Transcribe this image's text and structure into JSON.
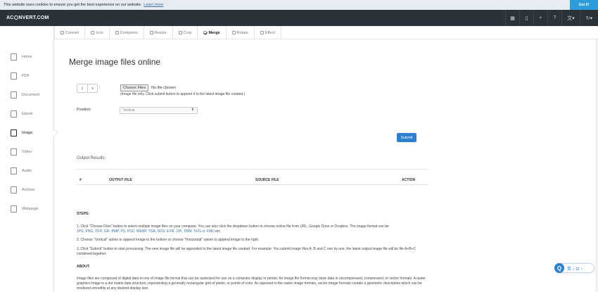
{
  "cookie": {
    "text": "This website uses cookies to ensure you get the best experience on our website.",
    "link": "Learn more",
    "button": "Got it!"
  },
  "topnav": {
    "logo_left": "AC",
    "logo_right": "NVERT.COM",
    "icons": [
      {
        "name": "grid-icon",
        "glyph": "▦"
      },
      {
        "name": "mobile-icon",
        "glyph": "▯"
      },
      {
        "name": "search-icon",
        "glyph": "⌕"
      },
      {
        "name": "help-icon",
        "glyph": "?"
      },
      {
        "name": "language-icon",
        "glyph": "文▾"
      },
      {
        "name": "refresh-icon",
        "glyph": "↻▾"
      }
    ]
  },
  "tabs": [
    {
      "label": "Convert",
      "active": false
    },
    {
      "label": "Icon",
      "active": false
    },
    {
      "label": "Compress",
      "active": false
    },
    {
      "label": "Resize",
      "active": false
    },
    {
      "label": "Crop",
      "active": false
    },
    {
      "label": "Merge",
      "active": true
    },
    {
      "label": "Rotate",
      "active": false
    },
    {
      "label": "Effect",
      "active": false
    }
  ],
  "sidebar": {
    "items": [
      {
        "label": "Home",
        "icon": "home-icon",
        "active": false
      },
      {
        "label": "PDF",
        "icon": "pdf-icon",
        "active": false
      },
      {
        "label": "Document",
        "icon": "document-icon",
        "active": false
      },
      {
        "label": "Ebook",
        "icon": "ebook-icon",
        "active": false
      },
      {
        "label": "Image",
        "icon": "image-icon",
        "active": true
      },
      {
        "label": "Video",
        "icon": "video-icon",
        "active": false
      },
      {
        "label": "Audio",
        "icon": "audio-icon",
        "active": false
      },
      {
        "label": "Archive",
        "icon": "archive-icon",
        "active": false
      },
      {
        "label": "Webpage",
        "icon": "webpage-icon",
        "active": false
      }
    ]
  },
  "main": {
    "title": "Merge image files online",
    "choose_button": "Choose Files",
    "file_status": "No file chosen",
    "hint": "(Image file only. Click submit button to append it to the latest image file created.)",
    "position_label": "Position:",
    "position_value": "Vertical",
    "submit": "Submit",
    "output_label": "Output Results:",
    "table_headers": [
      "#",
      "OUTPUT FILE",
      "SOURCE FILE",
      "ACTION"
    ]
  },
  "steps": {
    "heading": "STEPS:",
    "step1": "1. Click \"Choose Files\" button to select multiple image files on your computer. You can also click the dropdown button to choose online file from URL, Google Drive or Dropbox. The image format can be",
    "step1_formats": "JPG, PNG, TIFF, GIF, BMP, PS, PSD, WEBP, TGA, DDS, EXR, J2K, PNM, SVG or XWD",
    "step1_end": " etc.",
    "step2": "2. Choose \"Vertical\" option to append image to the bottom or choose \"Horizontal\" option to append image to the right.",
    "step3": "3. Click \"Submit\" button to start processing. The new image file will be appended to the latest image file created. For example: You submit image files A, B and C one by one, the latest output image file will be file A+B+C combined together.",
    "about_heading": "ABOUT:",
    "about": "Image files are composed of digital data in one of image file format that can be rasterized for use on a computer display or printer. An image file format may store data in uncompressed, compressed, or vector formats. A raster graphics image is a dot matrix data structure, representing a generally rectangular grid of pixels, or points of color. As opposed to the raster image formats, vector image formats contain a geometric description which can be rendered smoothly at any desired display size."
  },
  "widget": {
    "badge": "Q",
    "tools": "英 ♪ ⊡ ♀"
  }
}
